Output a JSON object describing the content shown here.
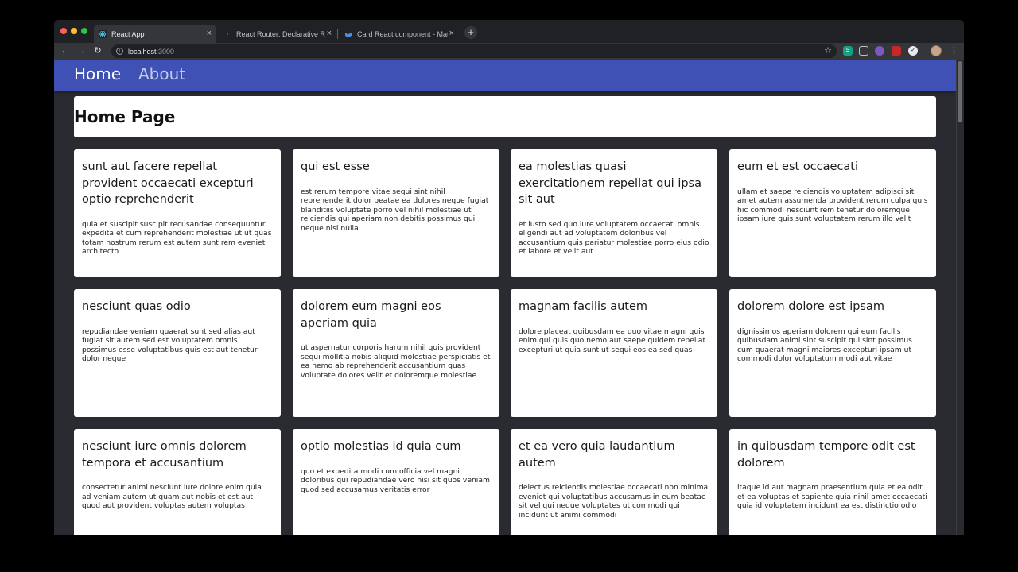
{
  "browser": {
    "tabs": [
      {
        "title": "React App",
        "favicon": "react-icon",
        "active": true
      },
      {
        "title": "React Router: Declarative Routing",
        "favicon": "react-router-icon",
        "active": false
      },
      {
        "title": "Card React component - Material",
        "favicon": "mui-icon",
        "active": false
      }
    ],
    "url_host": "localhost",
    "url_rest": ":3000"
  },
  "appbar": {
    "links": [
      {
        "label": "Home"
      },
      {
        "label": "About"
      }
    ]
  },
  "page": {
    "title": "Home Page"
  },
  "cards": [
    {
      "title": "sunt aut facere repellat provident occaecati excepturi optio reprehenderit",
      "body": "quia et suscipit suscipit recusandae consequuntur expedita et cum reprehenderit molestiae ut ut quas totam nostrum rerum est autem sunt rem eveniet architecto"
    },
    {
      "title": "qui est esse",
      "body": "est rerum tempore vitae sequi sint nihil reprehenderit dolor beatae ea dolores neque fugiat blanditiis voluptate porro vel nihil molestiae ut reiciendis qui aperiam non debitis possimus qui neque nisi nulla"
    },
    {
      "title": "ea molestias quasi exercitationem repellat qui ipsa sit aut",
      "body": "et iusto sed quo iure voluptatem occaecati omnis eligendi aut ad voluptatem doloribus vel accusantium quis pariatur molestiae porro eius odio et labore et velit aut"
    },
    {
      "title": "eum et est occaecati",
      "body": "ullam et saepe reiciendis voluptatem adipisci sit amet autem assumenda provident rerum culpa quis hic commodi nesciunt rem tenetur doloremque ipsam iure quis sunt voluptatem rerum illo velit"
    },
    {
      "title": "nesciunt quas odio",
      "body": "repudiandae veniam quaerat sunt sed alias aut fugiat sit autem sed est voluptatem omnis possimus esse voluptatibus quis est aut tenetur dolor neque"
    },
    {
      "title": "dolorem eum magni eos aperiam quia",
      "body": "ut aspernatur corporis harum nihil quis provident sequi mollitia nobis aliquid molestiae perspiciatis et ea nemo ab reprehenderit accusantium quas voluptate dolores velit et doloremque molestiae"
    },
    {
      "title": "magnam facilis autem",
      "body": "dolore placeat quibusdam ea quo vitae magni quis enim qui quis quo nemo aut saepe quidem repellat excepturi ut quia sunt ut sequi eos ea sed quas"
    },
    {
      "title": "dolorem dolore est ipsam",
      "body": "dignissimos aperiam dolorem qui eum facilis quibusdam animi sint suscipit qui sint possimus cum quaerat magni maiores excepturi ipsam ut commodi dolor voluptatum modi aut vitae"
    },
    {
      "title": "nesciunt iure omnis dolorem tempora et accusantium",
      "body": "consectetur animi nesciunt iure dolore enim quia ad veniam autem ut quam aut nobis et est aut quod aut provident voluptas autem voluptas"
    },
    {
      "title": "optio molestias id quia eum",
      "body": "quo et expedita modi cum officia vel magni doloribus qui repudiandae vero nisi sit quos veniam quod sed accusamus veritatis error"
    },
    {
      "title": "et ea vero quia laudantium autem",
      "body": "delectus reiciendis molestiae occaecati non minima eveniet qui voluptatibus accusamus in eum beatae sit vel qui neque voluptates ut commodi qui incidunt ut animi commodi"
    },
    {
      "title": "in quibusdam tempore odit est dolorem",
      "body": "itaque id aut magnam praesentium quia et ea odit et ea voluptas et sapiente quia nihil amet occaecati quia id voluptatem incidunt ea est distinctio odio"
    }
  ],
  "colors": {
    "appbar": "#3f51b5",
    "page_background": "#2a2b30",
    "card_background": "#ffffff"
  }
}
